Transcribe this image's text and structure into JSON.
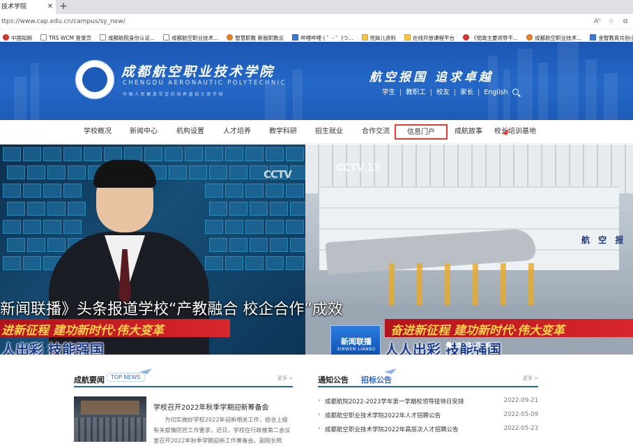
{
  "browser": {
    "tab_title": "技术学院",
    "url": "ttps://www.cap.edu.cn/campus/sy_new/",
    "reader_label": "Aʰ",
    "bookmarks": [
      {
        "label": "中国知网",
        "icon": "red"
      },
      {
        "label": "TRS WCM 登录页",
        "icon": "page"
      },
      {
        "label": "成都航院身份认证...",
        "icon": "page"
      },
      {
        "label": "成都航空职业技术...",
        "icon": "page"
      },
      {
        "label": "智慧职教 新版职教云",
        "icon": "org"
      },
      {
        "label": "哔哩哔哩 ( ゜- ゜)つ...",
        "icon": "blu"
      },
      {
        "label": "兜妹儿资料",
        "icon": "fld"
      },
      {
        "label": "在线开放课程平台",
        "icon": "fld"
      },
      {
        "label": "《党政主要领导干...",
        "icon": "red"
      },
      {
        "label": "成都航空职业技术...",
        "icon": "org"
      },
      {
        "label": "金智教育共创小助手",
        "icon": "blu"
      }
    ]
  },
  "header": {
    "name_cn": "成都航空职业技术学院",
    "name_en": "CHENGDU AERONAUTIC POLYTECHNIC",
    "subtitle": "中国人民解放军定向培养直招士官学校",
    "slogan": "航空报国  追求卓越",
    "quick_links": [
      "学生",
      "教职工",
      "校友",
      "家长",
      "English"
    ]
  },
  "nav": {
    "items": [
      "学校概况",
      "新闻中心",
      "机构设置",
      "人才培养",
      "教学科研",
      "招生就业",
      "合作交流",
      "信息门户",
      "成航故事",
      "校长培训基地"
    ]
  },
  "banner": {
    "cctv_left": "CCTV",
    "cctv_right": "CCTV 13",
    "caption": "新闻联播》头条报道学校“产教融合  校企合作”成效",
    "strap_left": "进新征程 建功新时代·伟大变革",
    "strap_right": "奋进新征程 建功新时代·伟大变革",
    "big_left": "人出彩 技能强国",
    "big_right": "人人出彩 技能强国",
    "wall_text": "航 空 报",
    "xwlb_cn": "新闻联播",
    "xwlb_en": "XINWEN LIANBO",
    "slide_count": 5,
    "active_slide": 0
  },
  "news": {
    "title": "成航要闻",
    "title_en": "TOP NEWS",
    "more": "更多 >",
    "headline": "学校召开2022年秋季学期迎新筹备会",
    "summary": "为切实做好学校2022年迎新相关工作，结合上级有关疫情防控工作要求，近日，学校在行政楼第二会议室召开2022年秋季学期迎新工作筹备会。副院长熊"
  },
  "notices": {
    "title": "通知公告",
    "tab2": "招标公告",
    "more": "更多 >",
    "items": [
      {
        "title": "成都航院2022-2023学年第一学期校领导接待日安排",
        "date": "2022-09-21"
      },
      {
        "title": "成都航空职业技术学院2022年人才招聘公告",
        "date": "2022-05-09"
      },
      {
        "title": "成都航空职业技术学院2022年高层次人才招聘公告",
        "date": "2022-05-23"
      }
    ]
  },
  "colors": {
    "brand_blue": "#1d5bb8",
    "highlight_red": "#e53935"
  }
}
